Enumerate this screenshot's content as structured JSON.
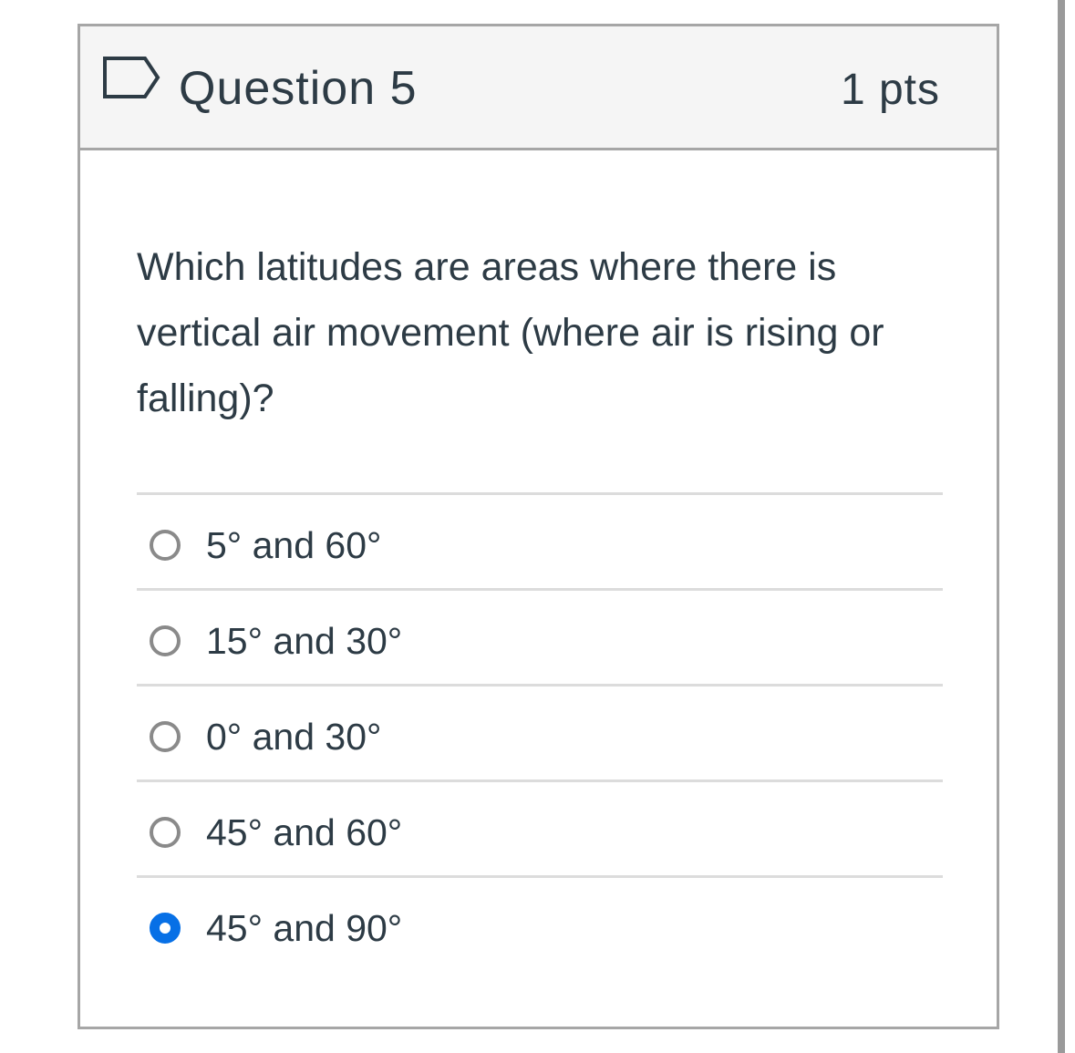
{
  "question": {
    "title": "Question 5",
    "points": "1 pts",
    "flag_icon": "bookmark-flag-icon",
    "text": "Which latitudes are areas where there is vertical air movement (where air is rising or falling)?"
  },
  "answers": [
    {
      "label": "5° and 60°",
      "selected": false
    },
    {
      "label": "15° and 30°",
      "selected": false
    },
    {
      "label": "0° and 30°",
      "selected": false
    },
    {
      "label": "45° and 60°",
      "selected": false
    },
    {
      "label": "45° and 90°",
      "selected": true
    }
  ],
  "colors": {
    "accent": "#0770e6",
    "header_bg": "#f5f5f5",
    "border": "#a6a6a6",
    "text": "#2d3b45"
  }
}
